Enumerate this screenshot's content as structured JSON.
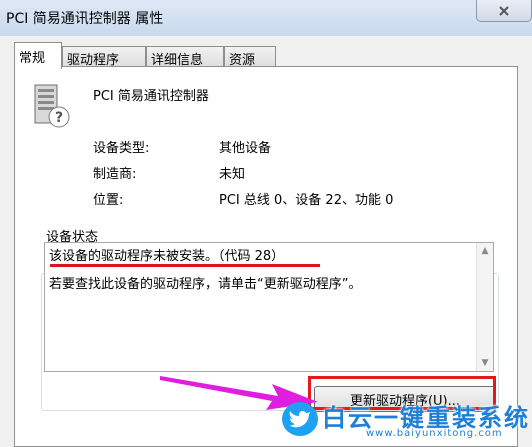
{
  "window": {
    "title": "PCI 简易通讯控制器 属性",
    "close_icon": "close-icon"
  },
  "tabs": [
    {
      "label": "常规",
      "active": true
    },
    {
      "label": "驱动程序",
      "active": false
    },
    {
      "label": "详细信息",
      "active": false
    },
    {
      "label": "资源",
      "active": false
    }
  ],
  "device": {
    "icon": "unknown-device-icon",
    "name": "PCI 简易通讯控制器",
    "properties": [
      {
        "label": "设备类型:",
        "value": "其他设备"
      },
      {
        "label": "制造商:",
        "value": "未知"
      },
      {
        "label": "位置:",
        "value": "PCI 总线 0、设备 22、功能 0"
      }
    ]
  },
  "status": {
    "group_label": "设备状态",
    "line1": "该设备的驱动程序未被安装。（代码 28）",
    "line2": "若要查找此设备的驱动程序，请单击“更新驱动程序”。"
  },
  "update_button": {
    "label": "更新驱动程序(U)..."
  },
  "annotations": {
    "underline_color": "#e0121b",
    "box_color": "#e41a1a",
    "arrow_color": "#e01ee0"
  },
  "watermark": {
    "text": "白云一键重装系统",
    "url": "www.baiyunxitong.com",
    "icon": "bird-icon"
  }
}
